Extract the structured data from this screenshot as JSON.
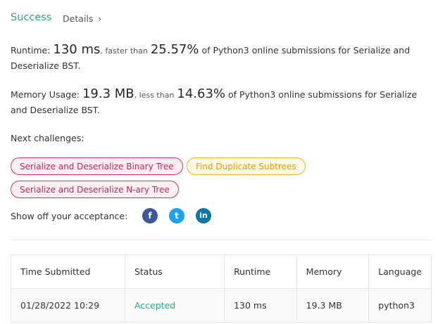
{
  "header": {
    "status": "Success",
    "details_label": "Details",
    "details_chevron": "›"
  },
  "runtime": {
    "label": "Runtime:",
    "value": "130 ms",
    "comparison": ", faster than",
    "percent": "25.57%",
    "suffix": "of Python3 online submissions for Serialize and Deserialize BST."
  },
  "memory": {
    "label": "Memory Usage:",
    "value": "19.3 MB",
    "comparison": ", less than",
    "percent": "14.63%",
    "suffix": "of Python3 online submissions for Serialize and Deserialize BST."
  },
  "next_challenges": {
    "label": "Next challenges:",
    "items": [
      {
        "label": "Serialize and Deserialize Binary Tree",
        "difficulty": "hard"
      },
      {
        "label": "Find Duplicate Subtrees",
        "difficulty": "medium"
      },
      {
        "label": "Serialize and Deserialize N-ary Tree",
        "difficulty": "hard"
      }
    ]
  },
  "share": {
    "label": "Show off your acceptance:",
    "icons": [
      {
        "name": "facebook-icon",
        "glyph": "f",
        "color": "#3b5998"
      },
      {
        "name": "twitter-icon",
        "glyph": "t",
        "color": "#1da1f2"
      },
      {
        "name": "linkedin-icon",
        "glyph": "in",
        "color": "#0e76a8"
      }
    ]
  },
  "submissions_table": {
    "headers": [
      "Time Submitted",
      "Status",
      "Runtime",
      "Memory",
      "Language"
    ],
    "rows": [
      {
        "time": "01/28/2022 10:29",
        "status": "Accepted",
        "runtime": "130 ms",
        "memory": "19.3 MB",
        "language": "python3"
      }
    ]
  },
  "colors": {
    "success": "#2ca58d",
    "hard": "#c2255c",
    "medium": "#e39b0d"
  }
}
